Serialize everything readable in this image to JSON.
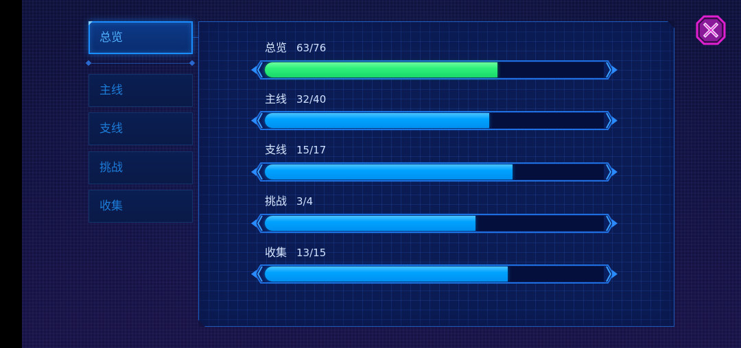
{
  "sidebar": {
    "tabs": [
      {
        "label": "总览",
        "active": true
      },
      {
        "label": "主线",
        "active": false
      },
      {
        "label": "支线",
        "active": false
      },
      {
        "label": "挑战",
        "active": false
      },
      {
        "label": "收集",
        "active": false
      }
    ]
  },
  "progress": [
    {
      "label": "总览",
      "count": "63/76",
      "current": 63,
      "total": 76,
      "color": "#2ef07a"
    },
    {
      "label": "主线",
      "count": "32/40",
      "current": 32,
      "total": 40,
      "color": "#00a2ff"
    },
    {
      "label": "支线",
      "count": "15/17",
      "current": 15,
      "total": 17,
      "color": "#00a2ff"
    },
    {
      "label": "挑战",
      "count": "3/4",
      "current": 3,
      "total": 4,
      "color": "#00a2ff"
    },
    {
      "label": "收集",
      "count": "13/15",
      "current": 13,
      "total": 15,
      "color": "#00a2ff"
    }
  ],
  "close_button": {
    "icon": "close-icon",
    "color": "#e020d0"
  },
  "theme": {
    "accent": "#1a8eff",
    "panel_bg": "#0b1c54",
    "track": "#050f3c"
  }
}
